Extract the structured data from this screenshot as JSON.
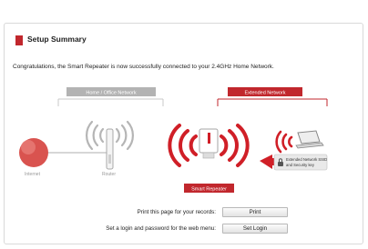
{
  "header": {
    "title": "Setup Summary"
  },
  "message": "Congratulations, the Smart Repeater is now successfully connected to your 2.4GHz Home Network.",
  "diagram": {
    "home_network_label": "Home / Office Network",
    "extended_network_label": "Extended Network",
    "internet_label": "Internet",
    "router_label": "Router",
    "repeater_label": "Smart Repeater",
    "ssid_badge_line1": "Extended Network SSID",
    "ssid_badge_line2": "and Security key"
  },
  "actions": {
    "print_prompt": "Print this page for your records:",
    "print_button": "Print",
    "login_prompt": "Set a login and password for the web menu:",
    "login_button": "Set Login"
  },
  "colors": {
    "accent": "#c1272d",
    "grey_label": "#b3b3b3"
  }
}
